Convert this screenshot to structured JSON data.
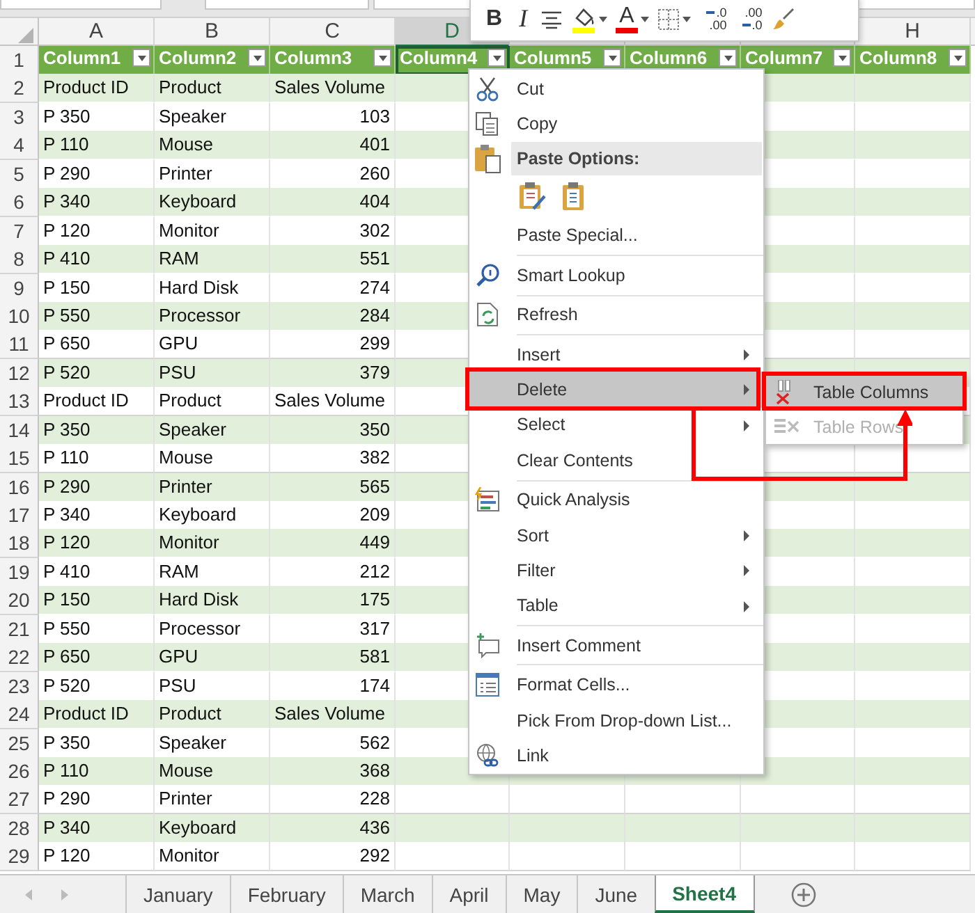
{
  "mini_toolbar": {
    "buttons": [
      {
        "kind": "bold",
        "label": "B"
      },
      {
        "kind": "italic",
        "label": "I"
      },
      {
        "kind": "center"
      },
      {
        "kind": "fill_color",
        "caret": true
      },
      {
        "kind": "font_color",
        "label": "A",
        "caret": true
      },
      {
        "kind": "borders",
        "caret": true
      },
      {
        "kind": "decimal_more",
        "top": ".0",
        "bottom": ".00"
      },
      {
        "kind": "decimal_less",
        "top": ".00",
        "bottom": ".0"
      },
      {
        "kind": "painter"
      }
    ]
  },
  "columns": [
    {
      "label": "A",
      "selected": false
    },
    {
      "label": "B",
      "selected": false
    },
    {
      "label": "C",
      "selected": false
    },
    {
      "label": "D",
      "selected": true
    },
    {
      "label": "H",
      "selected": false
    }
  ],
  "table": {
    "header": {
      "row": "1",
      "cells": [
        {
          "label": "Column1",
          "selected": false
        },
        {
          "label": "Column2",
          "selected": false
        },
        {
          "label": "Column3",
          "selected": false
        },
        {
          "label": "Column4",
          "selected": true
        },
        {
          "label": "Column5",
          "selected": false
        },
        {
          "label": "Column6",
          "selected": false
        },
        {
          "label": "Column7",
          "selected": false
        },
        {
          "label": "Column8",
          "selected": false
        }
      ]
    },
    "rows": [
      {
        "row": "2",
        "kind": "label",
        "cells": [
          "Product ID",
          "Product",
          "Sales Volume"
        ]
      },
      {
        "row": "3",
        "kind": "data",
        "cells": [
          "P 350",
          "Speaker",
          "103"
        ]
      },
      {
        "row": "4",
        "kind": "data",
        "cells": [
          "P 110",
          "Mouse",
          "401"
        ]
      },
      {
        "row": "5",
        "kind": "data",
        "cells": [
          "P 290",
          "Printer",
          "260"
        ]
      },
      {
        "row": "6",
        "kind": "data",
        "cells": [
          "P 340",
          "Keyboard",
          "404"
        ]
      },
      {
        "row": "7",
        "kind": "data",
        "cells": [
          "P 120",
          "Monitor",
          "302"
        ]
      },
      {
        "row": "8",
        "kind": "data",
        "cells": [
          "P 410",
          "RAM",
          "551"
        ]
      },
      {
        "row": "9",
        "kind": "data",
        "cells": [
          "P 150",
          "Hard Disk",
          "274"
        ]
      },
      {
        "row": "10",
        "kind": "data",
        "cells": [
          "P 550",
          "Processor",
          "284"
        ]
      },
      {
        "row": "11",
        "kind": "data",
        "cells": [
          "P 650",
          "GPU",
          "299"
        ]
      },
      {
        "row": "12",
        "kind": "data",
        "cells": [
          "P 520",
          "PSU",
          "379"
        ]
      },
      {
        "row": "13",
        "kind": "label",
        "cells": [
          "Product ID",
          "Product",
          "Sales Volume"
        ]
      },
      {
        "row": "14",
        "kind": "data",
        "cells": [
          "P 350",
          "Speaker",
          "350"
        ]
      },
      {
        "row": "15",
        "kind": "data",
        "cells": [
          "P 110",
          "Mouse",
          "382"
        ]
      },
      {
        "row": "16",
        "kind": "data",
        "cells": [
          "P 290",
          "Printer",
          "565"
        ]
      },
      {
        "row": "17",
        "kind": "data",
        "cells": [
          "P 340",
          "Keyboard",
          "209"
        ]
      },
      {
        "row": "18",
        "kind": "data",
        "cells": [
          "P 120",
          "Monitor",
          "449"
        ]
      },
      {
        "row": "19",
        "kind": "data",
        "cells": [
          "P 410",
          "RAM",
          "212"
        ]
      },
      {
        "row": "20",
        "kind": "data",
        "cells": [
          "P 150",
          "Hard Disk",
          "175"
        ]
      },
      {
        "row": "21",
        "kind": "data",
        "cells": [
          "P 550",
          "Processor",
          "317"
        ]
      },
      {
        "row": "22",
        "kind": "data",
        "cells": [
          "P 650",
          "GPU",
          "581"
        ]
      },
      {
        "row": "23",
        "kind": "data",
        "cells": [
          "P 520",
          "PSU",
          "174"
        ]
      },
      {
        "row": "24",
        "kind": "label",
        "cells": [
          "Product ID",
          "Product",
          "Sales Volume"
        ]
      },
      {
        "row": "25",
        "kind": "data",
        "cells": [
          "P 350",
          "Speaker",
          "562"
        ]
      },
      {
        "row": "26",
        "kind": "data",
        "cells": [
          "P 110",
          "Mouse",
          "368"
        ]
      },
      {
        "row": "27",
        "kind": "data",
        "cells": [
          "P 290",
          "Printer",
          "228"
        ]
      },
      {
        "row": "28",
        "kind": "data",
        "cells": [
          "P 340",
          "Keyboard",
          "436"
        ]
      },
      {
        "row": "29",
        "kind": "data",
        "cells": [
          "P 120",
          "Monitor",
          "292"
        ]
      }
    ]
  },
  "context_menu": {
    "items": [
      {
        "kind": "item",
        "label": "Cut",
        "submenu": false,
        "highlighted": false
      },
      {
        "kind": "item",
        "label": "Copy",
        "submenu": false,
        "highlighted": false
      },
      {
        "kind": "header",
        "label": "Paste Options:"
      },
      {
        "kind": "paste_icons"
      },
      {
        "kind": "item",
        "label": "Paste Special...",
        "submenu": false,
        "highlighted": false
      },
      {
        "kind": "separator"
      },
      {
        "kind": "item",
        "label": "Smart Lookup",
        "submenu": false,
        "highlighted": false
      },
      {
        "kind": "separator"
      },
      {
        "kind": "item",
        "label": "Refresh",
        "submenu": false,
        "highlighted": false
      },
      {
        "kind": "separator"
      },
      {
        "kind": "item",
        "label": "Insert",
        "submenu": true,
        "highlighted": false
      },
      {
        "kind": "item",
        "label": "Delete",
        "submenu": true,
        "highlighted": true
      },
      {
        "kind": "item",
        "label": "Select",
        "submenu": true,
        "highlighted": false
      },
      {
        "kind": "item",
        "label": "Clear Contents",
        "submenu": false,
        "highlighted": false
      },
      {
        "kind": "separator"
      },
      {
        "kind": "item",
        "label": "Quick Analysis",
        "submenu": false,
        "highlighted": false
      },
      {
        "kind": "item",
        "label": "Sort",
        "submenu": true,
        "highlighted": false
      },
      {
        "kind": "item",
        "label": "Filter",
        "submenu": true,
        "highlighted": false
      },
      {
        "kind": "item",
        "label": "Table",
        "submenu": true,
        "highlighted": false
      },
      {
        "kind": "separator"
      },
      {
        "kind": "item",
        "label": "Insert Comment",
        "submenu": false,
        "highlighted": false
      },
      {
        "kind": "separator"
      },
      {
        "kind": "item",
        "label": "Format Cells...",
        "submenu": false,
        "highlighted": false
      },
      {
        "kind": "item",
        "label": "Pick From Drop-down List...",
        "submenu": false,
        "highlighted": false
      },
      {
        "kind": "item",
        "label": "Link",
        "submenu": false,
        "highlighted": false
      }
    ]
  },
  "submenu": {
    "items": [
      {
        "label": "Table Columns",
        "highlighted": true,
        "disabled": false
      },
      {
        "label": "Table Rows",
        "highlighted": false,
        "disabled": true
      }
    ]
  },
  "sheet_tabs": [
    {
      "label": "January",
      "selected": false
    },
    {
      "label": "February",
      "selected": false
    },
    {
      "label": "March",
      "selected": false
    },
    {
      "label": "April",
      "selected": false
    },
    {
      "label": "May",
      "selected": false
    },
    {
      "label": "June",
      "selected": false
    },
    {
      "label": "Sheet4",
      "selected": true
    }
  ]
}
